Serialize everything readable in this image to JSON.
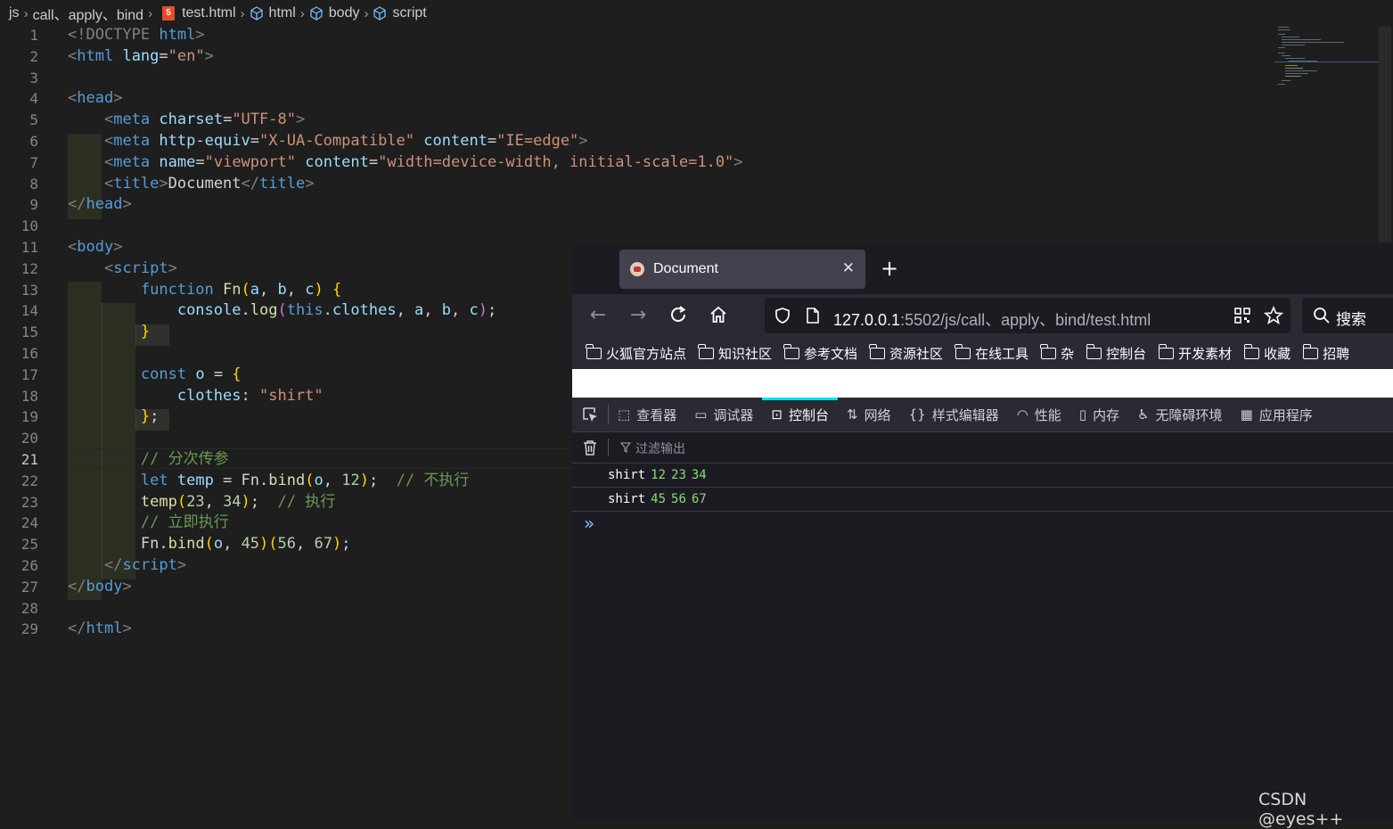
{
  "breadcrumb": [
    "js",
    "call、apply、bind",
    "test.html",
    "html",
    "body",
    "script"
  ],
  "editor": {
    "current_line": 21,
    "line_numbers": [
      "1",
      "2",
      "3",
      "4",
      "5",
      "6",
      "7",
      "8",
      "9",
      "10",
      "11",
      "12",
      "13",
      "14",
      "15",
      "16",
      "17",
      "18",
      "19",
      "20",
      "21",
      "22",
      "23",
      "24",
      "25",
      "26",
      "27",
      "28",
      "29"
    ]
  },
  "code": {
    "l1": [
      "<!DOCTYPE ",
      "html",
      ">"
    ],
    "l2": [
      "<",
      "html",
      " ",
      "lang",
      "=",
      "\"en\"",
      ">"
    ],
    "l4": [
      "<",
      "head",
      ">"
    ],
    "l5": [
      "<",
      "meta",
      " ",
      "charset",
      "=",
      "\"UTF-8\"",
      ">"
    ],
    "l6": [
      "<",
      "meta",
      " ",
      "http-equiv",
      "=",
      "\"X-UA-Compatible\"",
      " ",
      "content",
      "=",
      "\"IE=edge\"",
      ">"
    ],
    "l7": [
      "<",
      "meta",
      " ",
      "name",
      "=",
      "\"viewport\"",
      " ",
      "content",
      "=",
      "\"width=device-width, initial-scale=1.0\"",
      ">"
    ],
    "l8": [
      "<",
      "title",
      ">",
      "Document",
      "</",
      "title",
      ">"
    ],
    "l9": [
      "</",
      "head",
      ">"
    ],
    "l11": [
      "<",
      "body",
      ">"
    ],
    "l12": [
      "<",
      "script",
      ">"
    ],
    "l13": [
      "function",
      " ",
      "Fn",
      "(",
      "a",
      ", ",
      "b",
      ", ",
      "c",
      ")",
      " ",
      "{"
    ],
    "l14": [
      "console",
      ".",
      "log",
      "(",
      "this",
      ".",
      "clothes",
      ", ",
      "a",
      ", ",
      "b",
      ", ",
      "c",
      ")",
      ";"
    ],
    "l15": [
      "}"
    ],
    "l17": [
      "const",
      " ",
      "o",
      " = ",
      "{"
    ],
    "l18": [
      "clothes",
      ": ",
      "\"shirt\""
    ],
    "l19": [
      "}",
      ";"
    ],
    "l21": [
      "// 分次传参"
    ],
    "l22": [
      "let",
      " ",
      "temp",
      " = ",
      "Fn",
      ".",
      "bind",
      "(",
      "o",
      ", ",
      "12",
      ")",
      ";",
      "  ",
      "// 不执行"
    ],
    "l23": [
      "temp",
      "(",
      "23",
      ", ",
      "34",
      ")",
      ";",
      "  ",
      "// 执行"
    ],
    "l24": [
      "// 立即执行"
    ],
    "l25": [
      "Fn",
      ".",
      "bind",
      "(",
      "o",
      ", ",
      "45",
      ")",
      "(",
      "56",
      ", ",
      "67",
      ")",
      ";"
    ],
    "l26": [
      "</",
      "script",
      ">"
    ],
    "l27": [
      "</",
      "body",
      ">"
    ],
    "l29": [
      "</",
      "html",
      ">"
    ]
  },
  "browser": {
    "tab_title": "Document",
    "url_host": "127.0.0.1",
    "url_rest": ":5502/js/call、apply、bind/test.html",
    "search_placeholder": "搜索",
    "bookmarks": [
      "火狐官方站点",
      "知识社区",
      "参考文档",
      "资源社区",
      "在线工具",
      "杂",
      "控制台",
      "开发素材",
      "收藏",
      "招聘"
    ]
  },
  "devtools": {
    "tabs": [
      "查看器",
      "调试器",
      "控制台",
      "网络",
      "样式编辑器",
      "性能",
      "内存",
      "无障碍环境",
      "应用程序"
    ],
    "active_tab": "控制台",
    "filter_placeholder": "过滤输出",
    "logs": [
      {
        "text": "shirt",
        "nums": [
          "12",
          "23",
          "34"
        ]
      },
      {
        "text": "shirt",
        "nums": [
          "45",
          "56",
          "67"
        ]
      }
    ],
    "prompt": "»"
  },
  "watermark": "CSDN @eyes++",
  "colors": {
    "editor_bg": "#1e1e1e",
    "keyword": "#569cd6",
    "string": "#ce9178",
    "attr": "#9cdcfe",
    "comment": "#6a9955",
    "console_number": "#86de74",
    "devtools_accent": "#00ddff"
  }
}
